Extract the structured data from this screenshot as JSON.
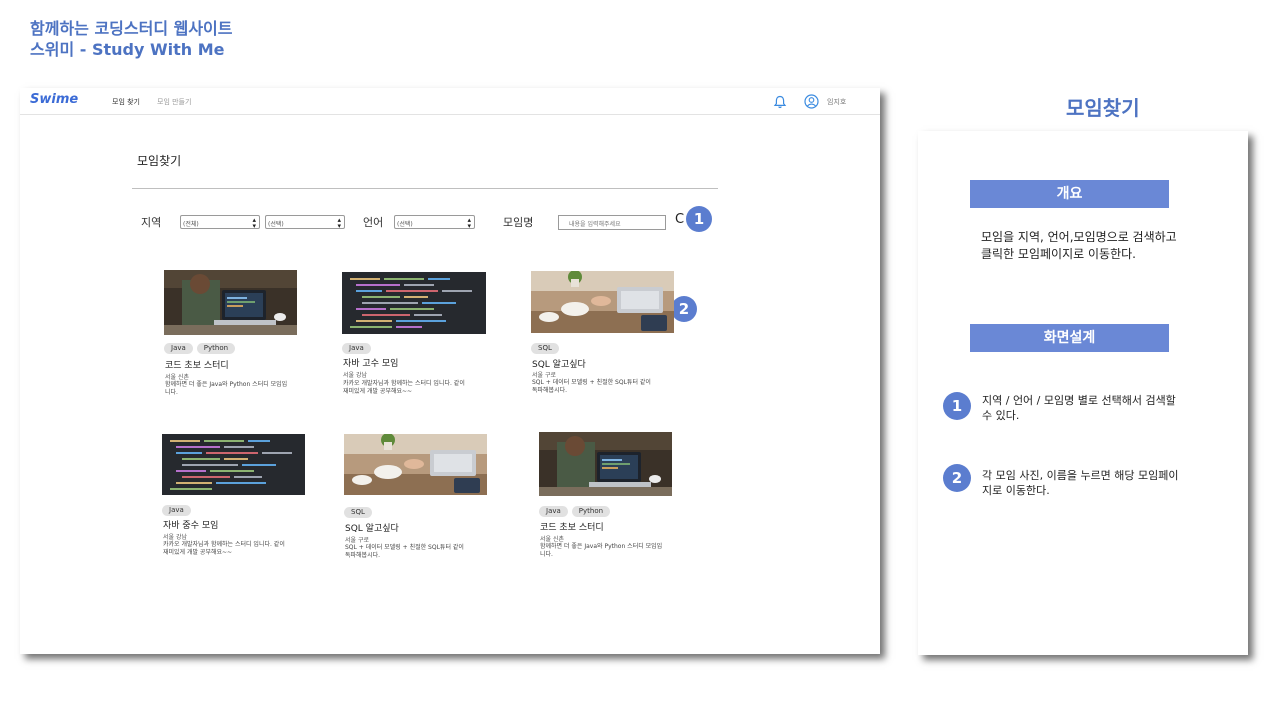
{
  "slide": {
    "title_line1": "함께하는 코딩스터디 웹사이트",
    "title_line2": "스위미 - Study With Me"
  },
  "nav": {
    "logo": "Swime",
    "link_find": "모임 찾기",
    "link_create": "모임 만들기",
    "bell_icon": "bell-icon",
    "user_icon": "user-circle-icon",
    "username": "임지호"
  },
  "filter": {
    "page_title": "모임찾기",
    "region_label": "지역",
    "region_select1": "(전체)",
    "region_select2": "(선택)",
    "lang_label": "언어",
    "lang_select": "(선택)",
    "name_label": "모임명",
    "search_placeholder": "내용을 입력해주세요",
    "search_icon": "search-icon"
  },
  "markers": {
    "one": "1",
    "two": "2"
  },
  "cards": [
    {
      "image": "laptop-person",
      "tags": [
        "Java",
        "Python"
      ],
      "title": "코드 초보 스터디",
      "location": "서울 신촌",
      "desc": "함께하면 더 좋은 Java와 Python 스터디 모임입니다."
    },
    {
      "image": "code-screen",
      "tags": [
        "Java"
      ],
      "title": "자바 고수 모임",
      "location": "서울 강남",
      "desc": "카카오 개발자님과 함께하는 스터디 입니다. 같이 재미있게 개발 공부해요~~"
    },
    {
      "image": "desk-laptop",
      "tags": [
        "SQL"
      ],
      "title": "SQL 알고싶다",
      "location": "서울 구로",
      "desc": "SQL + 데이터 모델링 + 친절한 SQL튜터 같이 독파해봅시다."
    },
    {
      "image": "code-screen",
      "tags": [
        "Java"
      ],
      "title": "자바 중수 모임",
      "location": "서울 강남",
      "desc": "카카오 개발자님과 함께하는 스터디 입니다. 같이 재미있게 개발 공부해요~~"
    },
    {
      "image": "desk-laptop",
      "tags": [
        "SQL"
      ],
      "title": "SQL 알고싶다",
      "location": "서울 구로",
      "desc": "SQL + 데이터 모델링 + 친절한 SQL튜터 같이 독파해봅시다."
    },
    {
      "image": "laptop-person",
      "tags": [
        "Java",
        "Python"
      ],
      "title": "코드 초보 스터디",
      "location": "서울 신촌",
      "desc": "함께하면 더 좋은 Java와 Python 스터디 모임입니다."
    }
  ],
  "side": {
    "title": "모임찾기",
    "overview_head": "개요",
    "overview_text": "모임을 지역, 언어,모임명으로 검색하고 클릭한 모임페이지로 이동한다.",
    "design_head": "화면설계",
    "item1_num": "1",
    "item1_text": "지역 / 언어 / 모임명 별로 선택해서 검색할 수 있다.",
    "item2_num": "2",
    "item2_text": "각 모임 사진, 이름을 누르면 해당 모임페이지로 이동한다."
  },
  "colors": {
    "accent": "#4d73c2",
    "header_fill": "#6a88d6",
    "badge": "#5b7dcf",
    "logo": "#3b6bd6"
  }
}
